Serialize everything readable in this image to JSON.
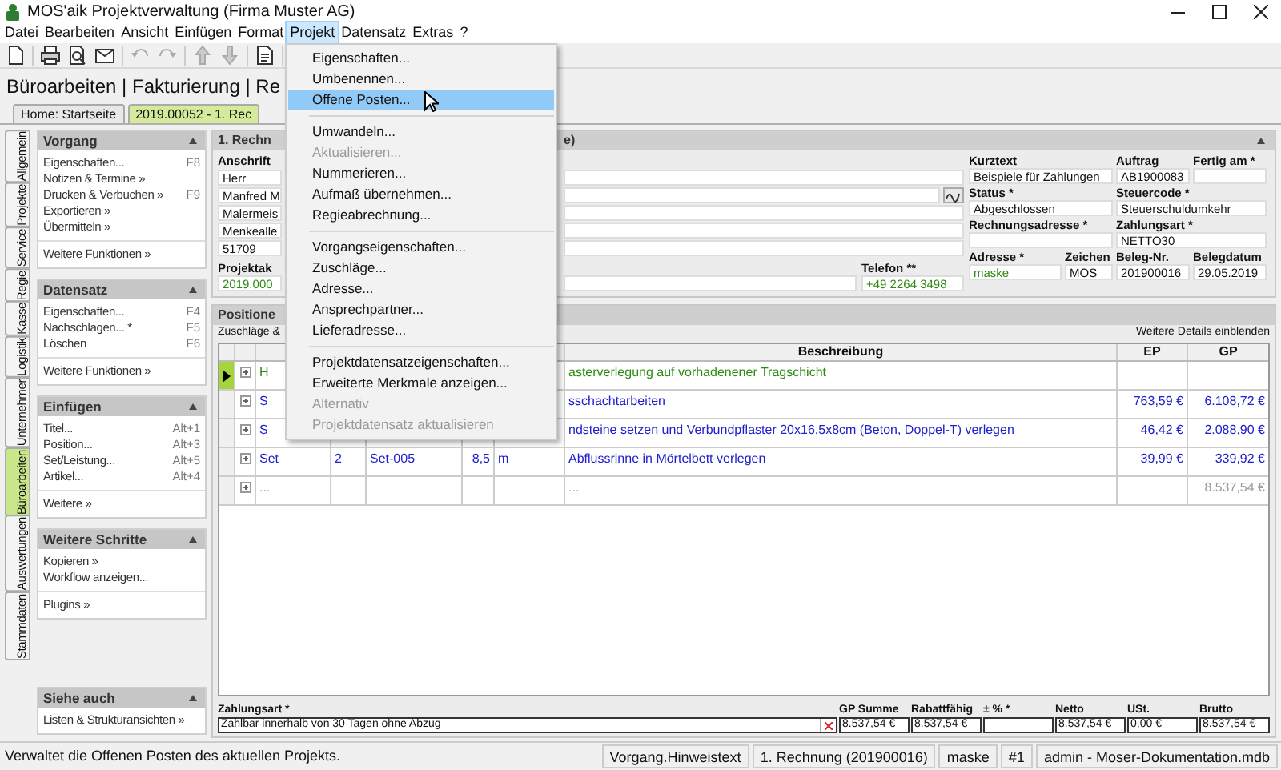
{
  "window": {
    "title": "MOS'aik Projektverwaltung (Firma Muster AG)"
  },
  "menu": [
    {
      "label": "Datei",
      "selected": false
    },
    {
      "label": "Bearbeiten",
      "selected": false
    },
    {
      "label": "Ansicht",
      "selected": false
    },
    {
      "label": "Einfügen",
      "selected": false
    },
    {
      "label": "Format",
      "selected": false
    },
    {
      "label": "Projekt",
      "selected": true
    },
    {
      "label": "Datensatz",
      "selected": false
    },
    {
      "label": "Extras",
      "selected": false
    },
    {
      "label": "?",
      "selected": false
    }
  ],
  "page_title": "Büroarbeiten | Fakturierung | Re",
  "doc_tabs": [
    {
      "label": "Home: Startseite",
      "selected": false
    },
    {
      "label": "2019.00052 - 1. Rec",
      "selected": true
    }
  ],
  "side_tabs": [
    {
      "label": "Allgemein",
      "selected": false
    },
    {
      "label": "Projekte",
      "selected": false
    },
    {
      "label": "Service",
      "selected": false
    },
    {
      "label": "Regie",
      "selected": false
    },
    {
      "label": "Kasse",
      "selected": false
    },
    {
      "label": "Logistik",
      "selected": false
    },
    {
      "label": "Unternehmer",
      "selected": false
    },
    {
      "label": "Büroarbeiten",
      "selected": true
    },
    {
      "label": "Auswertungen",
      "selected": false
    },
    {
      "label": "Stammdaten",
      "selected": false
    }
  ],
  "task_panel": [
    {
      "title": "Vorgang",
      "groups": [
        [
          {
            "label": "Eigenschaften...",
            "shortcut": "F8"
          },
          {
            "label": "Notizen & Termine »"
          },
          {
            "label": "Drucken & Verbuchen »",
            "shortcut": "F9"
          },
          {
            "label": "Exportieren »"
          },
          {
            "label": "Übermitteln »"
          }
        ],
        [
          {
            "label": "Weitere Funktionen »"
          }
        ]
      ]
    },
    {
      "title": "Datensatz",
      "groups": [
        [
          {
            "label": "Eigenschaften...",
            "shortcut": "F4"
          },
          {
            "label": "Nachschlagen... *",
            "shortcut": "F5"
          },
          {
            "label": "Löschen",
            "shortcut": "F6"
          }
        ],
        [
          {
            "label": "Weitere Funktionen »"
          }
        ]
      ]
    },
    {
      "title": "Einfügen",
      "groups": [
        [
          {
            "label": "Titel...",
            "shortcut": "Alt+1"
          },
          {
            "label": "Position...",
            "shortcut": "Alt+3"
          },
          {
            "label": "Set/Leistung...",
            "shortcut": "Alt+5"
          },
          {
            "label": "Artikel...",
            "shortcut": "Alt+4"
          }
        ],
        [
          {
            "label": "Weitere »"
          }
        ]
      ]
    },
    {
      "title": "Weitere Schritte",
      "groups": [
        [
          {
            "label": "Kopieren »"
          },
          {
            "label": "Workflow anzeigen..."
          }
        ],
        [
          {
            "label": "Plugins »"
          }
        ]
      ]
    },
    {
      "title": "Siehe auch",
      "groups": [
        [
          {
            "label": "Listen & Strukturansichten »"
          }
        ]
      ]
    }
  ],
  "header_panel": {
    "title": "1. Rechn",
    "title_tail": "e)",
    "address_label": "Anschrift",
    "address_lines": [
      "Herr",
      "Manfred M",
      "Malermeis",
      "Menkealle",
      "51709"
    ],
    "project": {
      "label": "Projektak",
      "value": "2019.000",
      "linked": true
    },
    "phone": {
      "label": "Telefon **",
      "value": "+49 2264 3498",
      "linked": true
    },
    "field_rows": [
      [
        {
          "label": "Kurztext",
          "value": "Beispiele für Zahlungen",
          "linked": false
        },
        {
          "label": "Auftrag",
          "value": "AB1900083",
          "linked": false
        },
        {
          "label": "Fertig am *"
        }
      ],
      [
        {
          "label": "Status *",
          "value": "Abgeschlossen",
          "linked": false
        },
        {
          "label": "Steuercode *",
          "value": "Steuerschuldumkehr",
          "linked": false
        }
      ],
      [
        {
          "label": "Rechnungsadresse *"
        },
        {
          "label": "Zahlungsart *",
          "value": "NETTO30",
          "linked": false
        }
      ],
      [
        {
          "label": "Adresse *",
          "value": "maske",
          "linked": true
        },
        {
          "label": "Zeichen",
          "value": "MOS",
          "linked": false
        },
        {
          "label": "Beleg-Nr.",
          "value": "201900016",
          "linked": false
        },
        {
          "label": "Belegdatum",
          "value": "29.05.2019",
          "linked": false
        }
      ]
    ]
  },
  "positions": {
    "title": "Positione",
    "left_note": "Zuschläge &",
    "right_link": "Weitere Details einblenden",
    "headers": {
      "description": "Beschreibung",
      "ep": "EP",
      "gp": "GP"
    },
    "rows": [
      {
        "kind": "title",
        "selected": true,
        "type": "H",
        "description": "asterverlegung auf vorhadenener Tragschicht"
      },
      {
        "kind": "item",
        "selected": false,
        "type": "S",
        "description": "sschachtarbeiten",
        "ep": "763,59 €",
        "gp": "6.108,72 €"
      },
      {
        "kind": "item",
        "selected": false,
        "type": "S",
        "description": "ndsteine setzen und Verbundpflaster 20x16,5x8cm (Beton, Doppel-T) verlegen",
        "ep": "46,42 €",
        "gp": "2.088,90 €"
      },
      {
        "kind": "item",
        "selected": false,
        "type": "Set",
        "qty": "2",
        "number": "Set-005",
        "amount": "8,5",
        "unit": "m",
        "description": "Abflussrinne in Mörtelbett verlegen",
        "ep": "39,99 €",
        "gp": "339,92 €"
      },
      {
        "kind": "empty",
        "selected": false,
        "type": "...",
        "description": "...",
        "gp": "8.537,54 €"
      }
    ]
  },
  "totals": {
    "payment_label": "Zahlungsart *",
    "payment_value": "Zahlbar innerhalb von 30 Tagen ohne Abzug",
    "amounts": [
      {
        "label": "GP Summe",
        "value": "8.537,54 €"
      },
      {
        "label": "Rabattfähig",
        "value": "8.537,54 €"
      },
      {
        "label": "± % *"
      },
      {
        "label": "Netto",
        "value": "8.537,54 €"
      },
      {
        "label": "USt.",
        "value": "0,00 €"
      },
      {
        "label": "Brutto",
        "value": "8.537,54 €"
      }
    ]
  },
  "status_bar": {
    "message": "Verwaltet die Offenen Posten des aktuellen Projekts.",
    "panes": [
      "Vorgang.Hinweistext",
      "1. Rechnung (201900016)",
      "maske",
      "#1",
      "admin - Moser-Dokumentation.mdb"
    ]
  },
  "project_menu": [
    {
      "kind": "item",
      "label": "Eigenschaften...",
      "selected": false,
      "disabled": false
    },
    {
      "kind": "item",
      "label": "Umbenennen...",
      "selected": false,
      "disabled": false
    },
    {
      "kind": "item",
      "label": "Offene Posten...",
      "selected": true,
      "disabled": false
    },
    {
      "kind": "separator"
    },
    {
      "kind": "item",
      "label": "Umwandeln...",
      "selected": false,
      "disabled": false
    },
    {
      "kind": "item",
      "label": "Aktualisieren...",
      "selected": false,
      "disabled": true
    },
    {
      "kind": "item",
      "label": "Nummerieren...",
      "selected": false,
      "disabled": false
    },
    {
      "kind": "item",
      "label": "Aufmaß übernehmen...",
      "selected": false,
      "disabled": false
    },
    {
      "kind": "item",
      "label": "Regieabrechnung...",
      "selected": false,
      "disabled": false
    },
    {
      "kind": "separator"
    },
    {
      "kind": "item",
      "label": "Vorgangseigenschaften...",
      "selected": false,
      "disabled": false
    },
    {
      "kind": "item",
      "label": "Zuschläge...",
      "selected": false,
      "disabled": false
    },
    {
      "kind": "item",
      "label": "Adresse...",
      "selected": false,
      "disabled": false
    },
    {
      "kind": "item",
      "label": "Ansprechpartner...",
      "selected": false,
      "disabled": false
    },
    {
      "kind": "item",
      "label": "Lieferadresse...",
      "selected": false,
      "disabled": false
    },
    {
      "kind": "separator"
    },
    {
      "kind": "item",
      "label": "Projektdatensatzeigenschaften...",
      "selected": false,
      "disabled": false
    },
    {
      "kind": "item",
      "label": "Erweiterte Merkmale anzeigen...",
      "selected": false,
      "disabled": false
    },
    {
      "kind": "item",
      "label": "Alternativ",
      "selected": false,
      "disabled": true
    },
    {
      "kind": "item",
      "label": "Projektdatensatz aktualisieren",
      "selected": false,
      "disabled": true
    }
  ]
}
